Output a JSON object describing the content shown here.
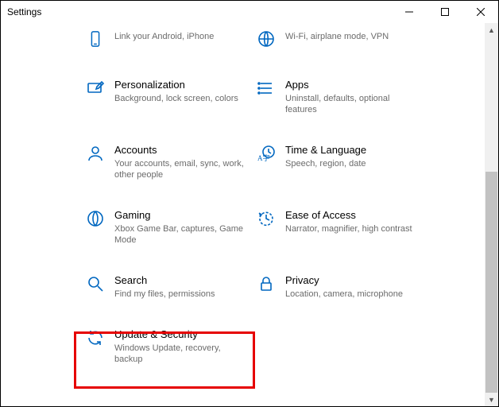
{
  "window": {
    "title": "Settings"
  },
  "tiles": [
    {
      "icon": "phone-icon",
      "title": "",
      "desc": "Link your Android, iPhone"
    },
    {
      "icon": "globe-icon",
      "title": "",
      "desc": "Wi-Fi, airplane mode, VPN"
    },
    {
      "icon": "personalization-icon",
      "title": "Personalization",
      "desc": "Background, lock screen, colors"
    },
    {
      "icon": "apps-icon",
      "title": "Apps",
      "desc": "Uninstall, defaults, optional features"
    },
    {
      "icon": "person-icon",
      "title": "Accounts",
      "desc": "Your accounts, email, sync, work, other people"
    },
    {
      "icon": "time-icon",
      "title": "Time & Language",
      "desc": "Speech, region, date"
    },
    {
      "icon": "gaming-icon",
      "title": "Gaming",
      "desc": "Xbox Game Bar, captures, Game Mode"
    },
    {
      "icon": "ease-icon",
      "title": "Ease of Access",
      "desc": "Narrator, magnifier, high contrast"
    },
    {
      "icon": "search-icon",
      "title": "Search",
      "desc": "Find my files, permissions"
    },
    {
      "icon": "lock-icon",
      "title": "Privacy",
      "desc": "Location, camera, microphone"
    },
    {
      "icon": "update-icon",
      "title": "Update & Security",
      "desc": "Windows Update, recovery, backup"
    }
  ],
  "highlight_index": 10
}
